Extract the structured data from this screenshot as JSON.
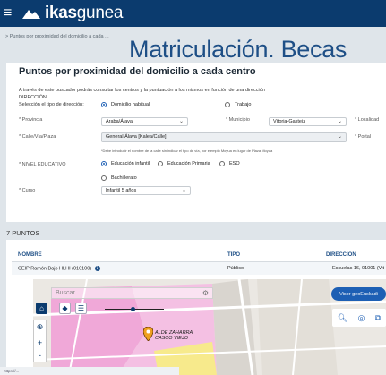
{
  "header": {
    "menu_icon": "hamburger-icon",
    "brand_bold": "ikas",
    "brand_rest": "gunea",
    "brand_color": "#0b3b6e"
  },
  "breadcrumb": "> Puntos por proximidad del domicilio a cada ...",
  "banner_title": "Matriculación. Becas",
  "form": {
    "title": "Puntos por proximidad del domicilio a cada centro",
    "intro": "A través de este buscador podrás consultar los centros y la puntuación a los mismos en función de una dirección",
    "direccion_heading": "DIRECCIÓN",
    "tipo_label": "Selección el tipo de dirección:",
    "tipo_options": [
      "Domicilio habitual",
      "Trabajo"
    ],
    "provincia_label": "* Provincia",
    "provincia_value": "Araba/Álava",
    "municipio_label": "* Municipio",
    "municipio_value": "Vitoria-Gasteiz",
    "localidad_label": "* Localidad",
    "calle_label": "* Calle/Vía/Plaza",
    "calle_value": "General Álava [Kalea/Calle]",
    "portal_label": "* Portal",
    "calle_hint": "*Debe introducir el nombre de la calle sin indicar el tipo de vía, por ejemplo Moyua en lugar de Plaza Moyua",
    "nivel_label": "* NIVEL EDUCATIVO",
    "nivel_options": [
      "Educación infantil",
      "Educación Primaria",
      "ESO",
      "Bachillerato"
    ],
    "curso_label": "* Curso",
    "curso_value": "Infantil 5 años"
  },
  "results": {
    "count": "7 PUNTOS",
    "columns": [
      "NOMBRE",
      "TIPO",
      "DIRECCIÓN"
    ],
    "rows": [
      {
        "nombre": "CEIP Ramón Bajo HLHI (010100)",
        "tipo": "Público",
        "direccion": "Escuelas 16, 01001 (Vit"
      }
    ]
  },
  "map": {
    "search_placeholder": "Buscar",
    "visor_button": "Visor geoEuskadi",
    "pin_label_line1": "ALDE ZAHARRA",
    "pin_label_line2": "CASCO VIEJO",
    "zoom_in": "+",
    "zoom_out": "-"
  },
  "status_url": "https://..."
}
